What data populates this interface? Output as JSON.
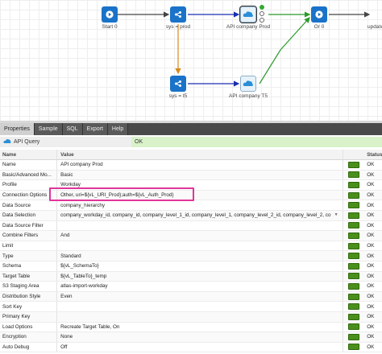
{
  "canvas": {
    "nodes": {
      "start": "Start 0",
      "sys_prod": "sys = prod",
      "api_prod": "API company Prod",
      "or": "Or 0",
      "update": "update",
      "sys_t5": "sys = t5",
      "api_t5": "API company T5"
    }
  },
  "tabs": [
    "Properties",
    "Sample",
    "SQL",
    "Export",
    "Help"
  ],
  "panel": {
    "title": "API Query",
    "status": "OK"
  },
  "grid": {
    "headers": {
      "name": "Name",
      "value": "Value",
      "status": "Status"
    },
    "rows": [
      {
        "name": "Name",
        "value": "API company Prod",
        "status": "OK"
      },
      {
        "name": "Basic/Advanced Mo...",
        "value": "Basic",
        "status": "OK"
      },
      {
        "name": "Profile",
        "value": "Workday",
        "status": "OK"
      },
      {
        "name": "Connection Options",
        "value": "Other, uri=${vL_URI_Prod};auth=${vL_Auth_Prod}",
        "status": "OK"
      },
      {
        "name": "Data Source",
        "value": "company_hierarchy",
        "status": "OK"
      },
      {
        "name": "Data Selection",
        "value": "company_workday_id, company_id, company_level_1_id, company_level_1, company_level_2_id, company_level_2, co",
        "status": "OK"
      },
      {
        "name": "Data Source Filter",
        "value": "",
        "status": "OK"
      },
      {
        "name": "Combine Filters",
        "value": "And",
        "status": "OK"
      },
      {
        "name": "Limit",
        "value": "",
        "status": "OK"
      },
      {
        "name": "Type",
        "value": "Standard",
        "status": "OK"
      },
      {
        "name": "Schema",
        "value": "${vL_SchemaTo}",
        "status": "OK"
      },
      {
        "name": "Target Table",
        "value": "${vL_TableTo}_temp",
        "status": "OK"
      },
      {
        "name": "S3 Staging Area",
        "value": "atlas-import-workday",
        "status": "OK"
      },
      {
        "name": "Distribution Style",
        "value": "Even",
        "status": "OK"
      },
      {
        "name": "Sort Key",
        "value": "",
        "status": "OK"
      },
      {
        "name": "Primary Key",
        "value": "",
        "status": "OK"
      },
      {
        "name": "Load Options",
        "value": "Recreate Target Table, On",
        "status": "OK"
      },
      {
        "name": "Encryption",
        "value": "None",
        "status": "OK"
      },
      {
        "name": "Auto Debug",
        "value": "Off",
        "status": "OK"
      }
    ]
  },
  "colors": {
    "accent": "#1a73c8",
    "ok_bg": "#d9f2c9",
    "button": "#4a8f1a",
    "highlight": "#e0359a"
  },
  "icons": {
    "start": "play-icon",
    "share": "share-icon",
    "api": "cloud-icon"
  }
}
